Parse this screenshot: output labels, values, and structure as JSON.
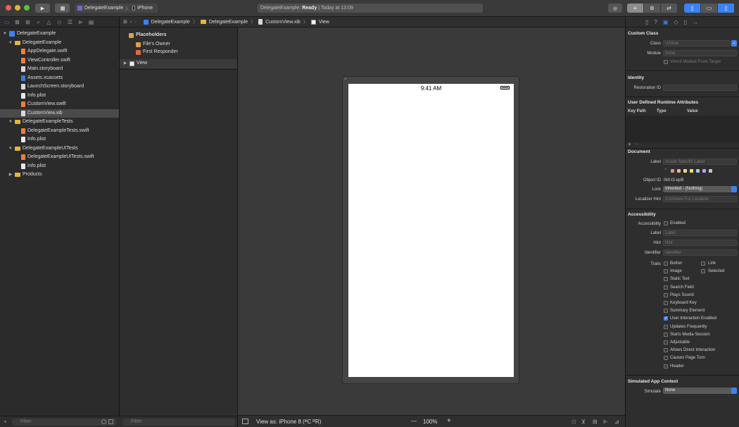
{
  "toolbar": {
    "scheme_target": "DelegateExample",
    "scheme_device": "iPhone",
    "activity_project": "DelegateExample:",
    "activity_status": "Ready",
    "activity_time": "| Today at 13:09"
  },
  "navigator": {
    "filter_placeholder": "Filter",
    "items": [
      {
        "label": "DelegateExample"
      },
      {
        "label": "DelegateExample"
      },
      {
        "label": "AppDelegate.swift"
      },
      {
        "label": "ViewController.swift"
      },
      {
        "label": "Main.storyboard"
      },
      {
        "label": "Assets.xcassets"
      },
      {
        "label": "LaunchScreen.storyboard"
      },
      {
        "label": "Info.plist"
      },
      {
        "label": "CustomView.swift"
      },
      {
        "label": "CustomView.xib"
      },
      {
        "label": "DelegateExampleTests"
      },
      {
        "label": "DelegateExampleTests.swift"
      },
      {
        "label": "Info.plist"
      },
      {
        "label": "DelegateExampleUITests"
      },
      {
        "label": "DelegateExampleUITests.swift"
      },
      {
        "label": "Info.plist"
      },
      {
        "label": "Products"
      }
    ]
  },
  "outline": {
    "placeholders": "Placeholders",
    "files_owner": "File's Owner",
    "first_responder": "First Responder",
    "view": "View",
    "filter_placeholder": "Filter"
  },
  "jumpbar": {
    "crumbs": [
      "DelegateExample",
      "DelegateExample",
      "CustomView.xib",
      "View"
    ]
  },
  "canvas": {
    "time": "9:41 AM",
    "view_as": "View as: iPhone 8 (ᴬC ᴿR)",
    "zoom": "100%",
    "zoom_out": "—",
    "zoom_in": "+"
  },
  "inspector": {
    "custom_class_header": "Custom Class",
    "class_label": "Class",
    "class_placeholder": "UIView",
    "module_label": "Module",
    "module_placeholder": "None",
    "inherit_label": "Inherit Module From Target",
    "identity_header": "Identity",
    "restoration_label": "Restoration ID",
    "udra_header": "User Defined Runtime Attributes",
    "col_keypath": "Key Path",
    "col_type": "Type",
    "col_value": "Value",
    "document_header": "Document",
    "label_label": "Label",
    "label_placeholder": "Xcode Specific Label",
    "swatch_x": "×",
    "object_id_label": "Object ID",
    "object_id_value": "iN0-l3-epB",
    "lock_label": "Lock",
    "lock_value": "Inherited - (Nothing)",
    "localizer_label": "Localizer Hint",
    "localizer_placeholder": "Comment For Localizer",
    "accessibility_header": "Accessibility",
    "accessibility_label": "Accessibility",
    "enabled_label": "Enabled",
    "acc_label_label": "Label",
    "acc_label_placeholder": "Label",
    "hint_label": "Hint",
    "hint_placeholder": "Hint",
    "identifier_label": "Identifier",
    "identifier_placeholder": "Identifier",
    "traits_label": "Traits",
    "traits": [
      {
        "label": "Button",
        "checked": false
      },
      {
        "label": "Image",
        "checked": false
      },
      {
        "label": "Static Text",
        "checked": false
      },
      {
        "label": "Search Field",
        "checked": false
      },
      {
        "label": "Plays Sound",
        "checked": false
      },
      {
        "label": "Keyboard Key",
        "checked": false
      },
      {
        "label": "Summary Element",
        "checked": false
      },
      {
        "label": "User Interaction Enabled",
        "checked": true
      },
      {
        "label": "Updates Frequently",
        "checked": false
      },
      {
        "label": "Starts Media Session",
        "checked": false
      },
      {
        "label": "Adjustable",
        "checked": false
      },
      {
        "label": "Allows Direct Interaction",
        "checked": false
      },
      {
        "label": "Causes Page Turn",
        "checked": false
      },
      {
        "label": "Header",
        "checked": false
      }
    ],
    "traits_right": [
      {
        "label": "Link",
        "checked": false
      },
      {
        "label": "Selected",
        "checked": false
      }
    ],
    "simulated_header": "Simulated App Context",
    "simulate_label": "Simulate",
    "simulate_value": "None"
  },
  "colors": {
    "accent": "#3b82f6",
    "swatches": [
      "#e58c8c",
      "#e5b78c",
      "#e5df8c",
      "#f0e06e",
      "#9ad0e8",
      "#b7a6e8",
      "#c8c8c8"
    ]
  }
}
